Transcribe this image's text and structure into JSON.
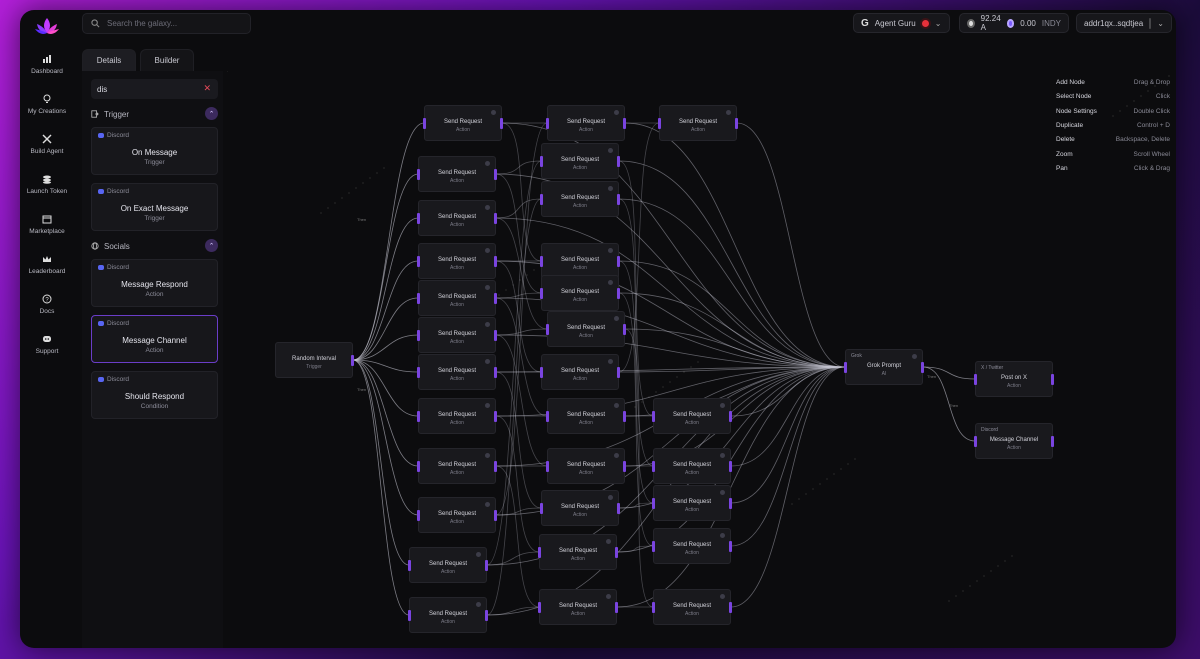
{
  "search": {
    "placeholder": "Search the galaxy..."
  },
  "header": {
    "agent_name": "Agent Guru",
    "balance_a": "92.24 A",
    "balance_indy": "0.00",
    "balance_indy_unit": "INDY",
    "address": "addr1qx..sqdtjea"
  },
  "nav": [
    {
      "label": "Dashboard",
      "icon": "bar-chart-icon"
    },
    {
      "label": "My Creations",
      "icon": "lightbulb-icon"
    },
    {
      "label": "Build Agent",
      "icon": "tools-icon"
    },
    {
      "label": "Launch Token",
      "icon": "coins-icon"
    },
    {
      "label": "Marketplace",
      "icon": "store-icon"
    },
    {
      "label": "Leaderboard",
      "icon": "crown-icon"
    },
    {
      "label": "Docs",
      "icon": "question-icon"
    },
    {
      "label": "Support",
      "icon": "discord-icon"
    }
  ],
  "panel": {
    "tabs": [
      "Details",
      "Builder"
    ],
    "filter_value": "dis",
    "sections": [
      {
        "name": "Trigger",
        "cards": [
          {
            "source": "Discord",
            "title": "On Message",
            "kind": "Trigger"
          },
          {
            "source": "Discord",
            "title": "On Exact Message",
            "kind": "Trigger"
          }
        ]
      },
      {
        "name": "Socials",
        "cards": [
          {
            "source": "Discord",
            "title": "Message Respond",
            "kind": "Action"
          },
          {
            "source": "Discord",
            "title": "Message Channel",
            "kind": "Action"
          },
          {
            "source": "Discord",
            "title": "Should Respond",
            "kind": "Condition"
          }
        ]
      }
    ]
  },
  "nodes": {
    "trigger": {
      "title": "Random Interval",
      "kind": "Trigger"
    },
    "request": {
      "title": "Send Request",
      "kind": "Action"
    },
    "grok": {
      "tag": "Grok",
      "title": "Grok Prompt",
      "kind": "AI"
    },
    "post_x": {
      "tag": "X / Twitter",
      "title": "Post on X",
      "kind": "Action"
    },
    "msg_channel": {
      "tag": "Discord",
      "title": "Message Channel",
      "kind": "Action"
    }
  },
  "edge_label": "Then",
  "shortcuts": [
    {
      "action": "Add Node",
      "key": "Drag & Drop"
    },
    {
      "action": "Select Node",
      "key": "Click"
    },
    {
      "action": "Node Settings",
      "key": "Double Click"
    },
    {
      "action": "Duplicate",
      "key": "Control + D"
    },
    {
      "action": "Delete",
      "key": "Backspace, Delete"
    },
    {
      "action": "Zoom",
      "key": "Scroll Wheel"
    },
    {
      "action": "Pan",
      "key": "Click & Drag"
    }
  ],
  "colors": {
    "accent": "#7a44e0",
    "error": "#e8313b",
    "discord": "#5865f2"
  }
}
